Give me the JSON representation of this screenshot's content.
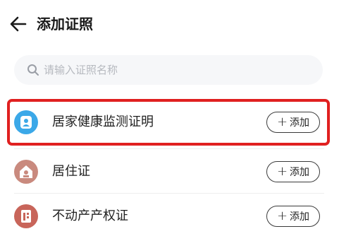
{
  "header": {
    "back_icon": "arrow-left-icon",
    "title": "添加证照"
  },
  "search": {
    "icon": "search-icon",
    "placeholder": "请输入证照名称",
    "value": ""
  },
  "certificates": [
    {
      "name": "居家健康监测证明",
      "icon": "user-badge-icon",
      "icon_color": "#3ba8e8",
      "highlighted": true,
      "add_label": "添加"
    },
    {
      "name": "居住证",
      "icon": "house-icon",
      "icon_color": "#c98a7e",
      "highlighted": false,
      "add_label": "添加"
    },
    {
      "name": "不动产产权证",
      "icon": "document-icon",
      "icon_color": "#c8655a",
      "highlighted": false,
      "add_label": "添加"
    }
  ],
  "plus_symbol": "+",
  "colors": {
    "highlight_border": "#e02020",
    "search_background": "#f6f7f9"
  }
}
